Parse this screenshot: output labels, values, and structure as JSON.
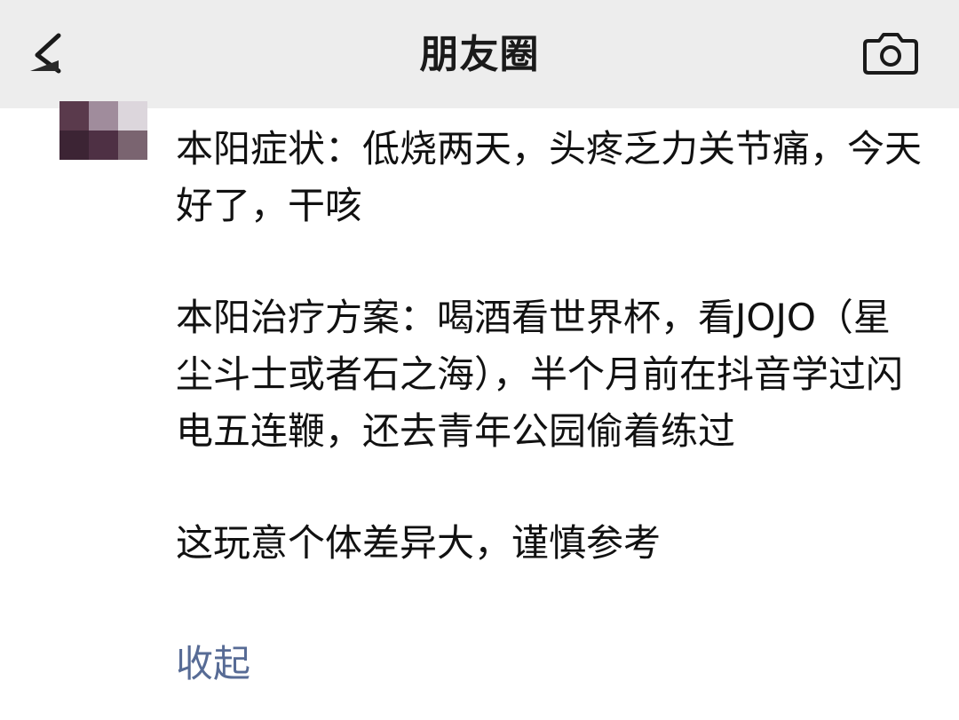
{
  "nav": {
    "title": "朋友圈",
    "back_icon": "chevron-left-icon",
    "camera_icon": "camera-icon"
  },
  "post": {
    "paragraphs": [
      "本阳症状：低烧两天，头疼乏力关节痛，今天好了，干咳",
      "本阳治疗方案：喝酒看世界杯，看JOJO（星尘斗士或者石之海），半个月前在抖音学过闪电五连鞭，还去青年公园偷着练过",
      "这玩意个体差异大，谨慎参考"
    ],
    "collapse_label": "收起"
  },
  "colors": {
    "nav_background": "#ededed",
    "link": "#576b95",
    "text": "#111111",
    "avatar_pixels": [
      "#5a3a4c",
      "#a08c9c",
      "#dcd6dc",
      "#3c2434",
      "#4e3044",
      "#7a6470"
    ]
  }
}
